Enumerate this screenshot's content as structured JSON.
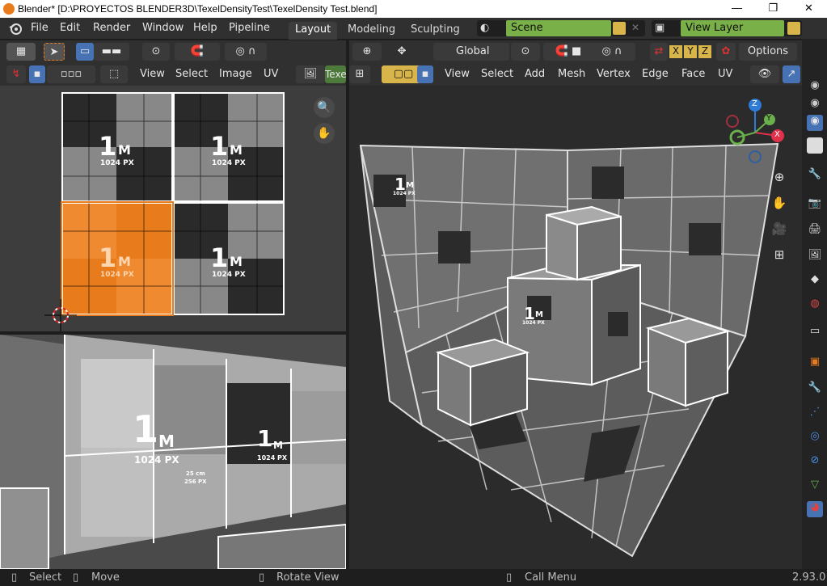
{
  "window": {
    "title": "Blender* [D:\\PROYECTOS BLENDER3D\\TexelDensityTest\\TexelDensity Test.blend]",
    "minimize": "—",
    "restore": "❐",
    "close": "✕"
  },
  "topmenu": {
    "items": [
      "File",
      "Edit",
      "Render",
      "Window",
      "Help",
      "Pipeline"
    ]
  },
  "workspaces": {
    "tabs": [
      "Layout",
      "Modeling",
      "Sculpting"
    ],
    "active": "Layout"
  },
  "scene": {
    "name": "Scene"
  },
  "view_layer": {
    "name": "View Layer"
  },
  "uv_header": {
    "menus": [
      "View",
      "Select",
      "Image",
      "UV"
    ],
    "texture_name": "Texe"
  },
  "viewport_header": {
    "orientation": "Global",
    "axis_x": "X",
    "axis_y": "Y",
    "axis_z": "Z",
    "options": "Options",
    "menus": [
      "View",
      "Select",
      "Add",
      "Mesh",
      "Vertex",
      "Edge",
      "Face",
      "UV"
    ]
  },
  "texture": {
    "big": "1",
    "unit": "M",
    "px": "1024 PX",
    "small_a": "25 cm",
    "small_b": "256 PX"
  },
  "gizmo": {
    "x": "X",
    "y": "Y",
    "z": "Z"
  },
  "statusbar": {
    "select": "Select",
    "move": "Move",
    "rotate": "Rotate View",
    "call_menu": "Call Menu",
    "version": "2.93.0"
  },
  "colors": {
    "accent_orange": "#e87b1c",
    "scene_green": "#7ab048",
    "header_bg": "#303030",
    "active_blue": "#4772b3"
  },
  "icons": [
    "blender-logo-icon",
    "pointer-icon",
    "box-select-icon",
    "proportional-icon",
    "snap-icon",
    "overlay-icon",
    "camera-icon",
    "hand-icon",
    "zoom-icon",
    "grid-icon",
    "wrench-icon",
    "material-icon"
  ]
}
